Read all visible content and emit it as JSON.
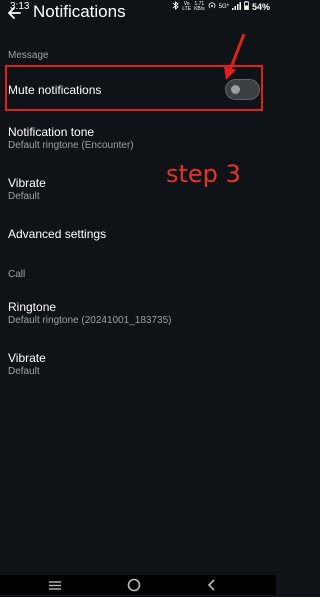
{
  "status_bar": {
    "time": "3:13",
    "net_top": "Vo",
    "net_bottom": "LTE",
    "speed_value": "1.71",
    "speed_unit": "KB/s",
    "network": "5G*",
    "battery": "54%"
  },
  "header": {
    "title": "Notifications"
  },
  "message_section": {
    "label": "Message",
    "mute": {
      "title": "Mute notifications",
      "enabled": false
    },
    "tone": {
      "title": "Notification tone",
      "value": "Default ringtone (Encounter)"
    },
    "vibrate": {
      "title": "Vibrate",
      "value": "Default"
    },
    "advanced": {
      "title": "Advanced settings"
    }
  },
  "call_section": {
    "label": "Call",
    "ringtone": {
      "title": "Ringtone",
      "value": "Default ringtone (20241001_183735)"
    },
    "vibrate": {
      "title": "Vibrate",
      "value": "Default"
    }
  },
  "annotation": {
    "text": "step 3",
    "color": "#e8322c"
  },
  "colors": {
    "background": "#0f1318",
    "highlight": "#e01f1f",
    "secondary_text": "#9aa0a6"
  }
}
